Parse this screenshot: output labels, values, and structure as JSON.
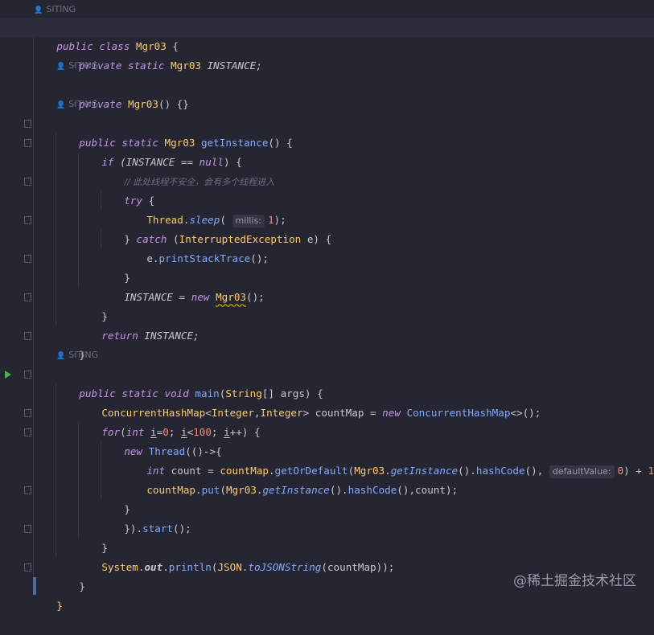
{
  "authors": {
    "siting": "SITING"
  },
  "watermark": "@稀土掘金技术社区",
  "code": {
    "l_class": [
      "public class ",
      "Mgr03",
      " {"
    ],
    "l_field": [
      "private static ",
      "Mgr03",
      " INSTANCE;"
    ],
    "l_ctor": [
      "private ",
      "Mgr03",
      "() {}"
    ],
    "l_getinst": [
      "public static ",
      "Mgr03",
      " ",
      "getInstance",
      "() {"
    ],
    "l_if": [
      "if",
      " (INSTANCE == ",
      "null",
      ") {"
    ],
    "l_comment": "// 此处线程不安全，会有多个线程进入",
    "l_try": [
      "try",
      " {"
    ],
    "l_sleep": [
      "Thread",
      ".",
      "sleep",
      "(",
      "millis:",
      "1",
      ");"
    ],
    "l_catch": [
      "} ",
      "catch",
      " (",
      "InterruptedException",
      " e) {"
    ],
    "l_print": [
      "e.",
      "printStackTrace",
      "();"
    ],
    "l_close": "}",
    "l_assign": [
      "INSTANCE = ",
      "new",
      " ",
      "Mgr03",
      "();"
    ],
    "l_return": [
      "return",
      " INSTANCE;"
    ],
    "l_main": [
      "public static void ",
      "main",
      "(",
      "String",
      "[] args) {"
    ],
    "l_map": [
      "ConcurrentHashMap",
      "<",
      "Integer",
      ",",
      "Integer",
      "> countMap = ",
      "new",
      " ",
      "ConcurrentHashMap",
      "<>();"
    ],
    "l_for": [
      "for",
      "(",
      "int",
      " ",
      "i",
      "=",
      "0",
      "; ",
      "i",
      "<",
      "100",
      "; ",
      "i",
      "++) {"
    ],
    "l_thread": [
      "new",
      " ",
      "Thread",
      "(()->{"
    ],
    "l_count": [
      "int",
      " count = ",
      "countMap",
      ".",
      "getOrDefault",
      "(",
      "Mgr03",
      ".",
      "getInstance",
      "().",
      "hashCode",
      "(), ",
      "defaultValue:",
      "0",
      ") + ",
      "1",
      ";"
    ],
    "l_put": [
      "countMap",
      ".",
      "put",
      "(",
      "Mgr03",
      ".",
      "getInstance",
      "().",
      "hashCode",
      "(),count);"
    ],
    "l_start": [
      "}).",
      "start",
      "();"
    ],
    "l_println": [
      "System",
      ".",
      "out",
      ".",
      "println",
      "(",
      "JSON",
      ".",
      "toJSONString",
      "(countMap));"
    ]
  }
}
